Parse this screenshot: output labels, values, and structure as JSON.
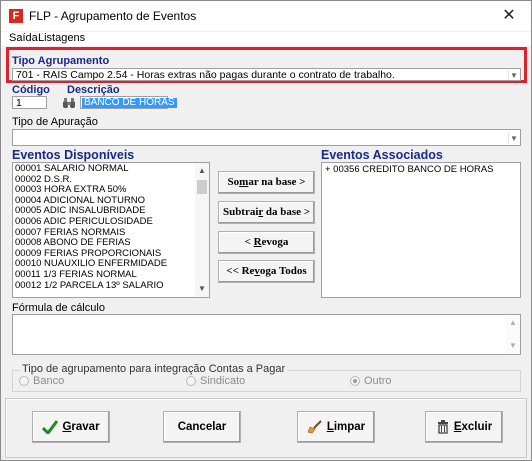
{
  "window": {
    "app_icon_letter": "F",
    "title": "FLP - Agrupamento de Eventos",
    "close_glyph": "✕"
  },
  "menu": {
    "items": [
      "Saída",
      "Listagens"
    ]
  },
  "tipo_agrupamento": {
    "label": "Tipo Agrupamento",
    "selected": "701 - RAIS Campo 2.54 - Horas extras não pagas durante o contrato de trabalho."
  },
  "codigo": {
    "label": "Código",
    "value": "1"
  },
  "descricao": {
    "label": "Descrição",
    "value": "BANCO DE HORAS"
  },
  "tipo_apuracao": {
    "label": "Tipo de Apuração",
    "value": ""
  },
  "eventos_disponiveis": {
    "label": "Eventos Disponíveis",
    "items": [
      "00001 SALARIO NORMAL",
      "00002 D.S.R.",
      "00003 HORA EXTRA 50%",
      "00004 ADICIONAL NOTURNO",
      "00005 ADIC INSALUBRIDADE",
      "00006 ADIC PERICULOSIDADE",
      "00007 FERIAS NORMAIS",
      "00008 ABONO DE FERIAS",
      "00009 FERIAS PROPORCIONAIS",
      "00010 NUAUXILIO ENFERMIDADE",
      "00011 1/3 FERIAS NORMAL",
      "00012 1/2 PARCELA 13º SALARIO"
    ]
  },
  "eventos_associados": {
    "label": "Eventos Associados",
    "items": [
      "+ 00356 CREDITO BANCO DE HORAS"
    ]
  },
  "middle_buttons": {
    "somar": {
      "pre": "So",
      "u": "m",
      "post": "ar  na base >"
    },
    "subtrair": {
      "pre": "Subtrai",
      "u": "r",
      "post": " da base >"
    },
    "revoga": {
      "pre": "< ",
      "u": "R",
      "post": "evoga"
    },
    "revoga_todos": {
      "pre": "<< Re",
      "u": "v",
      "post": "oga Todos"
    }
  },
  "formula": {
    "label": "Fórmula de cálculo",
    "value": ""
  },
  "integracao": {
    "label": "Tipo de agrupamento para integração Contas a Pagar",
    "options": [
      {
        "label": "Banco",
        "selected": false
      },
      {
        "label": "Sindicato",
        "selected": false
      },
      {
        "label": "Outro",
        "selected": true
      }
    ]
  },
  "bottom_buttons": {
    "gravar": {
      "u": "G",
      "post": "ravar"
    },
    "cancelar": {
      "label": "Cancelar"
    },
    "limpar": {
      "u": "L",
      "post": "impar"
    },
    "excluir": {
      "u": "E",
      "post": "xcluir"
    }
  },
  "colors": {
    "highlight_frame": "#e0202a",
    "section_title": "#1a2a8c",
    "selection": "#3399ff",
    "checkmark": "#1f8a1f"
  },
  "icons": {
    "app": "app-f-icon",
    "search": "binoculars-icon",
    "gravar": "checkmark-icon",
    "limpar": "broom-icon",
    "excluir": "trash-icon"
  }
}
